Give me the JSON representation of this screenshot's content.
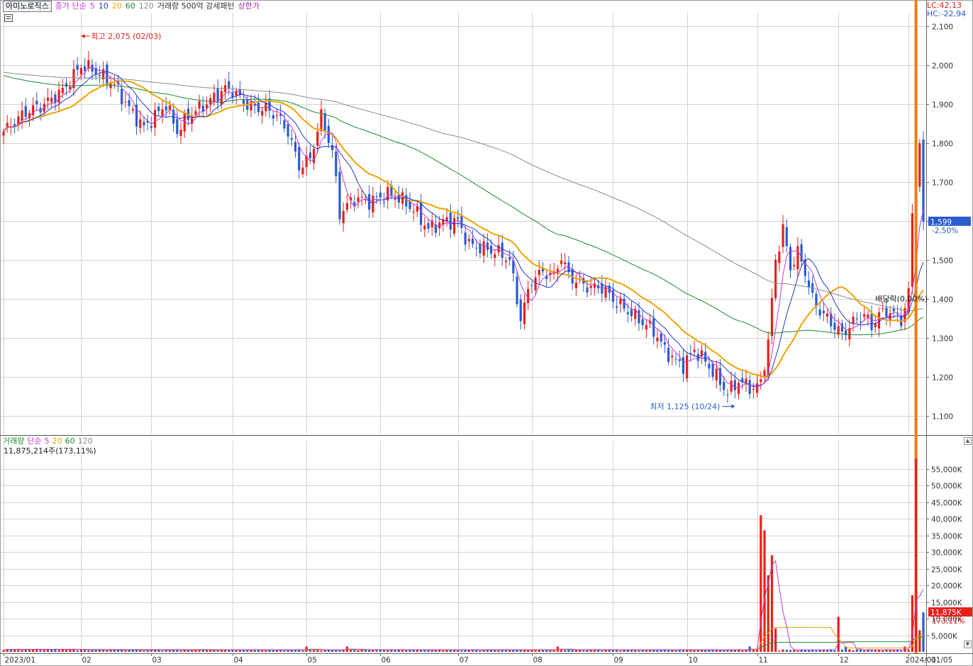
{
  "header": {
    "stock_name": "아미노로직스",
    "indicator_price": "종가 단순",
    "ma_periods": [
      {
        "label": "5",
        "color": "#c23bd6"
      },
      {
        "label": "10",
        "color": "#1f3bd0"
      },
      {
        "label": "20",
        "color": "#f0a202"
      },
      {
        "label": "60",
        "color": "#1a8a2e"
      },
      {
        "label": "120",
        "color": "#8a8a8a"
      }
    ],
    "volume_pattern": "거래량 500억 강세패턴",
    "upper_limit": "상한가"
  },
  "right_axis_header": {
    "lc": "LC:42,13",
    "hc": "HC:-22,94"
  },
  "volume_header": {
    "title": "거래량",
    "indicator": "단순",
    "periods": [
      {
        "label": "5",
        "color": "#c23bd6"
      },
      {
        "label": "20",
        "color": "#f0a202"
      },
      {
        "label": "60",
        "color": "#1a8a2e"
      },
      {
        "label": "120",
        "color": "#8a8a8a"
      }
    ],
    "info": "11,875,214주(173,11%)"
  },
  "colors": {
    "up": "#e8201a",
    "down": "#2a5bd0",
    "ma5": "#c23bd6",
    "ma10": "#1f3bd0",
    "ma20": "#f0a202",
    "ma60": "#1a8a2e",
    "ma120": "#8a8a8a",
    "grid": "#d3d3d3"
  },
  "chart_data": [
    {
      "type": "candlestick",
      "name": "price",
      "y_ticks": [
        "2,100",
        "2,000",
        "1,900",
        "1,800",
        "1,700",
        "1,600",
        "1,500",
        "1,400",
        "1,300",
        "1,200",
        "1,100"
      ],
      "y_tick_values": [
        2100,
        2000,
        1900,
        1800,
        1700,
        1600,
        1500,
        1400,
        1300,
        1200,
        1100
      ],
      "ylim": [
        1055,
        2135
      ],
      "months": [
        {
          "label": "2023/01",
          "index": 0
        },
        {
          "label": "02",
          "index": 21
        },
        {
          "label": "03",
          "index": 40
        },
        {
          "label": "04",
          "index": 62
        },
        {
          "label": "05",
          "index": 82
        },
        {
          "label": "06",
          "index": 102
        },
        {
          "label": "07",
          "index": 123
        },
        {
          "label": "08",
          "index": 143
        },
        {
          "label": "09",
          "index": 165
        },
        {
          "label": "10",
          "index": 185
        },
        {
          "label": "11",
          "index": 204
        },
        {
          "label": "12",
          "index": 226
        },
        {
          "label": "2024/01",
          "index": 245
        },
        {
          "label": "01/05",
          "index": 249
        }
      ],
      "anchors_close": [
        [
          0,
          1830
        ],
        [
          6,
          1880
        ],
        [
          11,
          1900
        ],
        [
          16,
          1935
        ],
        [
          21,
          2000
        ],
        [
          24,
          1990
        ],
        [
          27,
          1970
        ],
        [
          30,
          1950
        ],
        [
          34,
          1890
        ],
        [
          38,
          1840
        ],
        [
          40,
          1860
        ],
        [
          44,
          1900
        ],
        [
          47,
          1830
        ],
        [
          50,
          1870
        ],
        [
          53,
          1890
        ],
        [
          56,
          1910
        ],
        [
          60,
          1940
        ],
        [
          62,
          1935
        ],
        [
          65,
          1905
        ],
        [
          68,
          1890
        ],
        [
          71,
          1890
        ],
        [
          74,
          1870
        ],
        [
          77,
          1830
        ],
        [
          80,
          1740
        ],
        [
          83,
          1760
        ],
        [
          86,
          1870
        ],
        [
          89,
          1780
        ],
        [
          91,
          1620
        ],
        [
          95,
          1660
        ],
        [
          99,
          1650
        ],
        [
          104,
          1670
        ],
        [
          107,
          1660
        ],
        [
          111,
          1630
        ],
        [
          115,
          1580
        ],
        [
          119,
          1600
        ],
        [
          123,
          1600
        ],
        [
          126,
          1540
        ],
        [
          130,
          1530
        ],
        [
          134,
          1520
        ],
        [
          137,
          1500
        ],
        [
          140,
          1350
        ],
        [
          143,
          1450
        ],
        [
          146,
          1470
        ],
        [
          149,
          1460
        ],
        [
          151,
          1510
        ],
        [
          153,
          1460
        ],
        [
          156,
          1440
        ],
        [
          159,
          1430
        ],
        [
          162,
          1430
        ],
        [
          166,
          1390
        ],
        [
          169,
          1370
        ],
        [
          173,
          1340
        ],
        [
          176,
          1320
        ],
        [
          179,
          1270
        ],
        [
          182,
          1240
        ],
        [
          184,
          1230
        ],
        [
          187,
          1270
        ],
        [
          190,
          1240
        ],
        [
          193,
          1200
        ],
        [
          196,
          1160
        ],
        [
          199,
          1190
        ],
        [
          203,
          1170
        ],
        [
          205,
          1185
        ],
        [
          207,
          1290
        ],
        [
          209,
          1500
        ],
        [
          211,
          1580
        ],
        [
          213,
          1480
        ],
        [
          215,
          1520
        ],
        [
          217,
          1470
        ],
        [
          219,
          1400
        ],
        [
          221,
          1370
        ],
        [
          223,
          1350
        ],
        [
          225,
          1330
        ],
        [
          227,
          1310
        ],
        [
          229,
          1330
        ],
        [
          231,
          1350
        ],
        [
          233,
          1360
        ],
        [
          235,
          1330
        ],
        [
          237,
          1360
        ],
        [
          239,
          1370
        ],
        [
          241,
          1360
        ],
        [
          243,
          1350
        ],
        [
          244,
          1370
        ],
        [
          245,
          1420
        ],
        [
          246,
          1620
        ],
        [
          247,
          1700
        ],
        [
          248,
          1800
        ],
        [
          249,
          1599
        ]
      ],
      "highlights": {
        "high_label": "최고 2,075 (02/03)",
        "high_value": 2075,
        "high_index": 21,
        "low_label": "최저 1,125 (10/24)",
        "low_value": 1125,
        "low_index": 198
      },
      "current_price": {
        "label": "1,599",
        "change": "-2,50%",
        "value": 1599
      },
      "dividend_label": "배당락(0,00%)"
    },
    {
      "type": "bar",
      "name": "volume",
      "y_ticks": [
        "55,000K",
        "50,000K",
        "45,000K",
        "40,000K",
        "35,000K",
        "30,000K",
        "25,000K",
        "20,000K",
        "15,000K",
        "10,000K",
        "5,000K"
      ],
      "y_tick_values": [
        55000,
        50000,
        45000,
        40000,
        35000,
        30000,
        25000,
        20000,
        15000,
        10000,
        5000
      ],
      "ylim": [
        0,
        60000
      ],
      "unit": "K",
      "spikes": [
        [
          205,
          41000
        ],
        [
          206,
          36500
        ],
        [
          207,
          23000
        ],
        [
          208,
          29000
        ],
        [
          209,
          7000
        ],
        [
          226,
          10500
        ],
        [
          246,
          17000
        ],
        [
          247,
          58000
        ],
        [
          248,
          6500
        ],
        [
          249,
          11875
        ]
      ],
      "current_volume": {
        "label": "11,875K",
        "change": "173,11%",
        "value": 11875
      }
    }
  ]
}
